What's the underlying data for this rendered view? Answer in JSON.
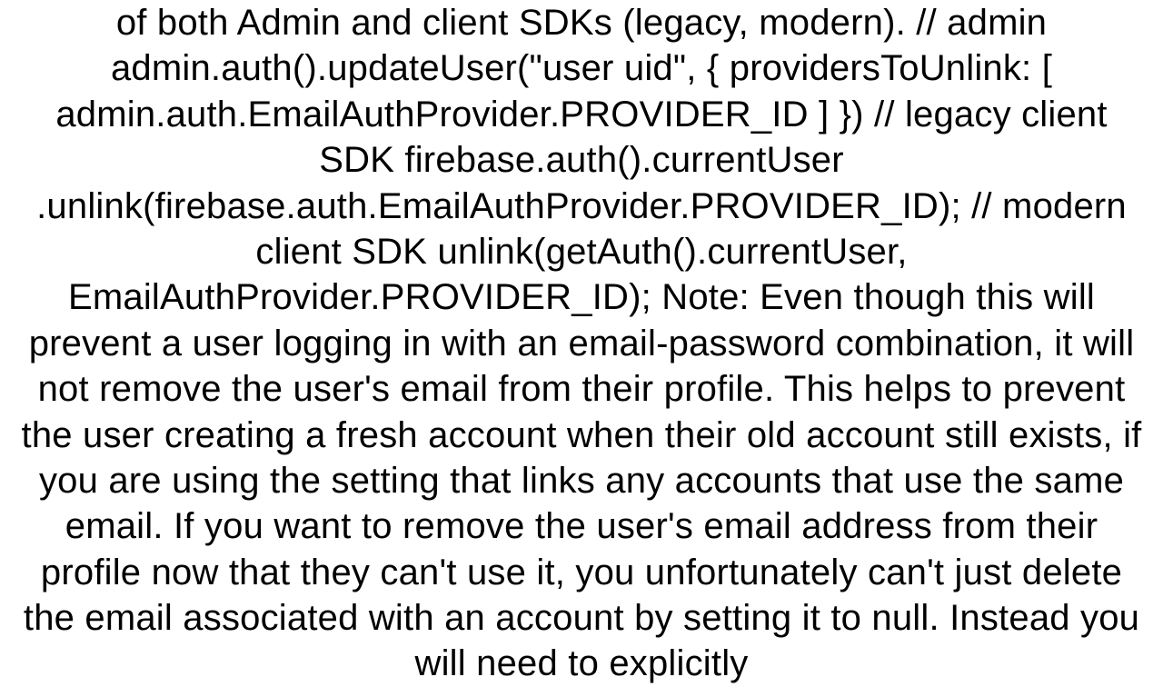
{
  "body": {
    "text": "of both Admin and client SDKs (legacy, modern). // admin admin.auth().updateUser(\"user uid\", {   providersToUnlink: [ admin.auth.EmailAuthProvider.PROVIDER_ID ] })  // legacy client SDK firebase.auth().currentUser .unlink(firebase.auth.EmailAuthProvider.PROVIDER_ID);  // modern client SDK unlink(getAuth().currentUser, EmailAuthProvider.PROVIDER_ID);  Note: Even though this will prevent a user logging in with an email-password combination, it will not remove the user's email from their profile. This helps to prevent the user creating a fresh account when their old account still exists, if you are using the setting that links any accounts that use the same email. If you want to remove the user's email address from their profile now that they can't use it, you unfortunately can't just delete the email associated with an account by setting it to null. Instead you will need to explicitly"
  }
}
